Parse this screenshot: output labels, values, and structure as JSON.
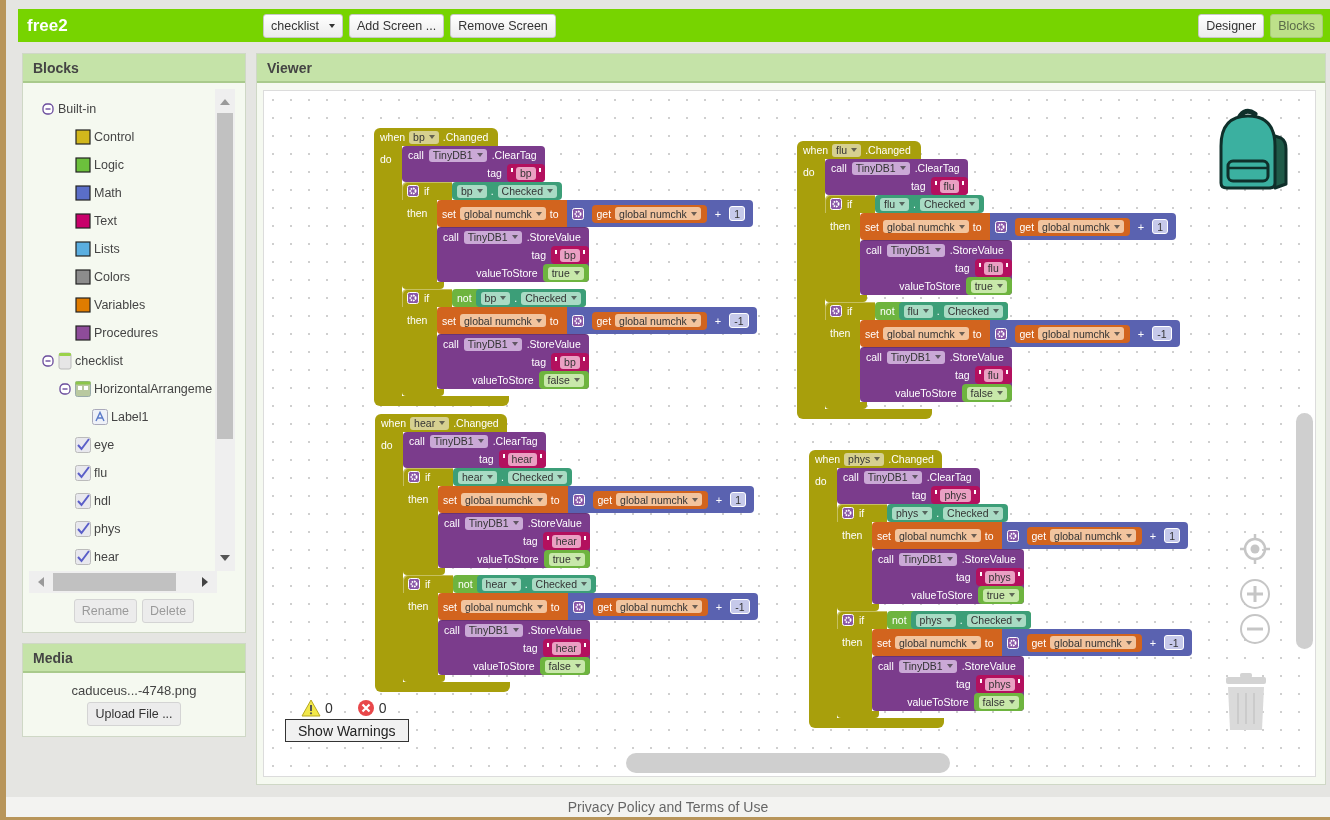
{
  "app_bar": {
    "title": "free2",
    "screen_dropdown": "checklist",
    "buttons": [
      {
        "label": "Add Screen ..."
      },
      {
        "label": "Remove Screen"
      }
    ],
    "views": [
      {
        "label": "Designer",
        "selected": false
      },
      {
        "label": "Blocks",
        "selected": true
      }
    ]
  },
  "blocks_panel": {
    "title": "Blocks",
    "tree": [
      {
        "label": "Built-in",
        "expanded": true,
        "children": [
          {
            "label": "Control",
            "kind": "category",
            "color": "#d1b71c"
          },
          {
            "label": "Logic",
            "kind": "category",
            "color": "#6cc03c"
          },
          {
            "label": "Math",
            "kind": "category",
            "color": "#5a6ec8"
          },
          {
            "label": "Text",
            "kind": "category",
            "color": "#c8006a"
          },
          {
            "label": "Lists",
            "kind": "category",
            "color": "#5aaee0"
          },
          {
            "label": "Colors",
            "kind": "category",
            "color": "#8c8c8c"
          },
          {
            "label": "Variables",
            "kind": "category",
            "color": "#e07c00"
          },
          {
            "label": "Procedures",
            "kind": "category",
            "color": "#8e4c9a"
          }
        ]
      },
      {
        "label": "checklist",
        "kind": "screen",
        "expanded": true,
        "children": [
          {
            "label": "HorizontalArrangeme",
            "kind": "arrangement",
            "expanded": true,
            "children": [
              {
                "label": "Label1",
                "kind": "label"
              }
            ]
          },
          {
            "label": "eye",
            "kind": "checkbox"
          },
          {
            "label": "flu",
            "kind": "checkbox"
          },
          {
            "label": "hdl",
            "kind": "checkbox"
          },
          {
            "label": "phys",
            "kind": "checkbox"
          },
          {
            "label": "hear",
            "kind": "checkbox"
          }
        ]
      }
    ],
    "buttons": [
      {
        "label": "Rename",
        "disabled": true
      },
      {
        "label": "Delete",
        "disabled": true
      }
    ]
  },
  "media_panel": {
    "title": "Media",
    "files": [
      "caduceus...-4748.png"
    ],
    "upload_button": "Upload File ..."
  },
  "viewer": {
    "title": "Viewer",
    "handlers": [
      {
        "when": "when",
        "component": "bp",
        "event": ".Changed",
        "do": "do",
        "clear": {
          "call": "call",
          "db": "TinyDB1",
          "method": ".ClearTag",
          "tag": "tag",
          "value": "bp"
        },
        "ifs": [
          {
            "if": "if",
            "then": "then",
            "condition": {
              "component": "bp",
              "dot": ".",
              "property": "Checked"
            },
            "set": {
              "set": "set",
              "variable": "global numchk",
              "to": "to",
              "get": "get",
              "get_variable": "global numchk",
              "operator": "+",
              "number": "1"
            },
            "store": {
              "call": "call",
              "db": "TinyDB1",
              "method": ".StoreValue",
              "tag": "tag",
              "tag_value": "bp",
              "value_label": "valueToStore",
              "value": "true"
            }
          },
          {
            "if": "if",
            "then": "then",
            "condition": {
              "not": "not",
              "component": "bp",
              "dot": ".",
              "property": "Checked"
            },
            "set": {
              "set": "set",
              "variable": "global numchk",
              "to": "to",
              "get": "get",
              "get_variable": "global numchk",
              "operator": "+",
              "number": "-1"
            },
            "store": {
              "call": "call",
              "db": "TinyDB1",
              "method": ".StoreValue",
              "tag": "tag",
              "tag_value": "bp",
              "value_label": "valueToStore",
              "value": "false"
            }
          }
        ]
      },
      {
        "when": "when",
        "component": "flu",
        "event": ".Changed",
        "do": "do",
        "clear": {
          "call": "call",
          "db": "TinyDB1",
          "method": ".ClearTag",
          "tag": "tag",
          "value": "flu"
        },
        "ifs": [
          {
            "if": "if",
            "then": "then",
            "condition": {
              "component": "flu",
              "dot": ".",
              "property": "Checked"
            },
            "set": {
              "set": "set",
              "variable": "global numchk",
              "to": "to",
              "get": "get",
              "get_variable": "global numchk",
              "operator": "+",
              "number": "1"
            },
            "store": {
              "call": "call",
              "db": "TinyDB1",
              "method": ".StoreValue",
              "tag": "tag",
              "tag_value": "flu",
              "value_label": "valueToStore",
              "value": "true"
            }
          },
          {
            "if": "if",
            "then": "then",
            "condition": {
              "not": "not",
              "component": "flu",
              "dot": ".",
              "property": "Checked"
            },
            "set": {
              "set": "set",
              "variable": "global numchk",
              "to": "to",
              "get": "get",
              "get_variable": "global numchk",
              "operator": "+",
              "number": "-1"
            },
            "store": {
              "call": "call",
              "db": "TinyDB1",
              "method": ".StoreValue",
              "tag": "tag",
              "tag_value": "flu",
              "value_label": "valueToStore",
              "value": "false"
            }
          }
        ]
      },
      {
        "when": "when",
        "component": "hear",
        "event": ".Changed",
        "do": "do",
        "clear": {
          "call": "call",
          "db": "TinyDB1",
          "method": ".ClearTag",
          "tag": "tag",
          "value": "hear"
        },
        "ifs": [
          {
            "if": "if",
            "then": "then",
            "condition": {
              "component": "hear",
              "dot": ".",
              "property": "Checked"
            },
            "set": {
              "set": "set",
              "variable": "global numchk",
              "to": "to",
              "get": "get",
              "get_variable": "global numchk",
              "operator": "+",
              "number": "1"
            },
            "store": {
              "call": "call",
              "db": "TinyDB1",
              "method": ".StoreValue",
              "tag": "tag",
              "tag_value": "hear",
              "value_label": "valueToStore",
              "value": "true"
            }
          },
          {
            "if": "if",
            "then": "then",
            "condition": {
              "not": "not",
              "component": "hear",
              "dot": ".",
              "property": "Checked"
            },
            "set": {
              "set": "set",
              "variable": "global numchk",
              "to": "to",
              "get": "get",
              "get_variable": "global numchk",
              "operator": "+",
              "number": "-1"
            },
            "store": {
              "call": "call",
              "db": "TinyDB1",
              "method": ".StoreValue",
              "tag": "tag",
              "tag_value": "hear",
              "value_label": "valueToStore",
              "value": "false"
            }
          }
        ]
      },
      {
        "when": "when",
        "component": "phys",
        "event": ".Changed",
        "do": "do",
        "clear": {
          "call": "call",
          "db": "TinyDB1",
          "method": ".ClearTag",
          "tag": "tag",
          "value": "phys"
        },
        "ifs": [
          {
            "if": "if",
            "then": "then",
            "condition": {
              "component": "phys",
              "dot": ".",
              "property": "Checked"
            },
            "set": {
              "set": "set",
              "variable": "global numchk",
              "to": "to",
              "get": "get",
              "get_variable": "global numchk",
              "operator": "+",
              "number": "1"
            },
            "store": {
              "call": "call",
              "db": "TinyDB1",
              "method": ".StoreValue",
              "tag": "tag",
              "tag_value": "phys",
              "value_label": "valueToStore",
              "value": "true"
            }
          },
          {
            "if": "if",
            "then": "then",
            "condition": {
              "not": "not",
              "component": "phys",
              "dot": ".",
              "property": "Checked"
            },
            "set": {
              "set": "set",
              "variable": "global numchk",
              "to": "to",
              "get": "get",
              "get_variable": "global numchk",
              "operator": "+",
              "number": "-1"
            },
            "store": {
              "call": "call",
              "db": "TinyDB1",
              "method": ".StoreValue",
              "tag": "tag",
              "tag_value": "phys",
              "value_label": "valueToStore",
              "value": "false"
            }
          }
        ]
      }
    ],
    "warnings": {
      "warning_count": "0",
      "error_count": "0",
      "button": "Show Warnings"
    }
  },
  "footer": {
    "link": "Privacy Policy and Terms of Use"
  }
}
